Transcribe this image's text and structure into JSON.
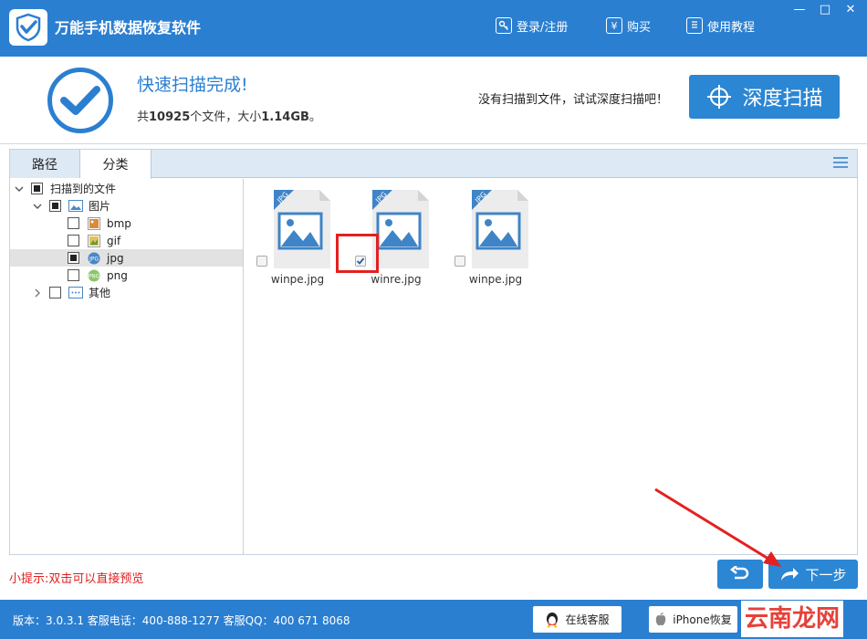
{
  "titlebar": {
    "app_title": "万能手机数据恢复软件",
    "links": [
      {
        "label": "登录/注册",
        "icon": "key-icon"
      },
      {
        "label": "购买",
        "icon": "yen-icon"
      },
      {
        "label": "使用教程",
        "icon": "book-icon"
      }
    ],
    "window_buttons": {
      "minimize": "—",
      "maximize": "□",
      "close": "✕"
    }
  },
  "header": {
    "status_title": "快速扫描完成!",
    "summary_prefix": "共",
    "file_count": "10925",
    "summary_mid": "个文件，大小",
    "total_size": "1.14GB",
    "summary_suffix": "。",
    "deep_hint": "没有扫描到文件，试试深度扫描吧！",
    "deep_scan_label": "深度扫描"
  },
  "tabs": [
    {
      "label": "路径",
      "active": false
    },
    {
      "label": "分类",
      "active": true
    }
  ],
  "tree": {
    "root": {
      "label": "扫描到的文件",
      "expanded": true,
      "checked": "partial"
    },
    "images": {
      "label": "图片",
      "expanded": true,
      "checked": "partial"
    },
    "types": [
      {
        "label": "bmp",
        "checked": "none",
        "selected": false
      },
      {
        "label": "gif",
        "checked": "none",
        "selected": false
      },
      {
        "label": "jpg",
        "checked": "partial",
        "selected": true
      },
      {
        "label": "png",
        "checked": "none",
        "selected": false
      }
    ],
    "other": {
      "label": "其他",
      "expanded": false,
      "checked": "none"
    }
  },
  "files": [
    {
      "name": "winpe.jpg",
      "badge": "JPG",
      "checked": false
    },
    {
      "name": "winre.jpg",
      "badge": "JPG",
      "checked": true
    },
    {
      "name": "winpe.jpg",
      "badge": "JPG",
      "checked": false
    }
  ],
  "bottom": {
    "tip": "小提示:双击可以直接预览",
    "next_label": "下一步"
  },
  "footer": {
    "info": "版本：3.0.3.1 客服电话：400-888-1277   客服QQ：400 671 8068",
    "service_label": "在线客服",
    "iphone_label": "iPhone恢复",
    "watermark": "云南龙网"
  },
  "colors": {
    "brand_blue": "#2b7fd1",
    "button_blue": "#2b86d4",
    "annotation_red": "#e42020",
    "tip_red": "#e02020"
  }
}
